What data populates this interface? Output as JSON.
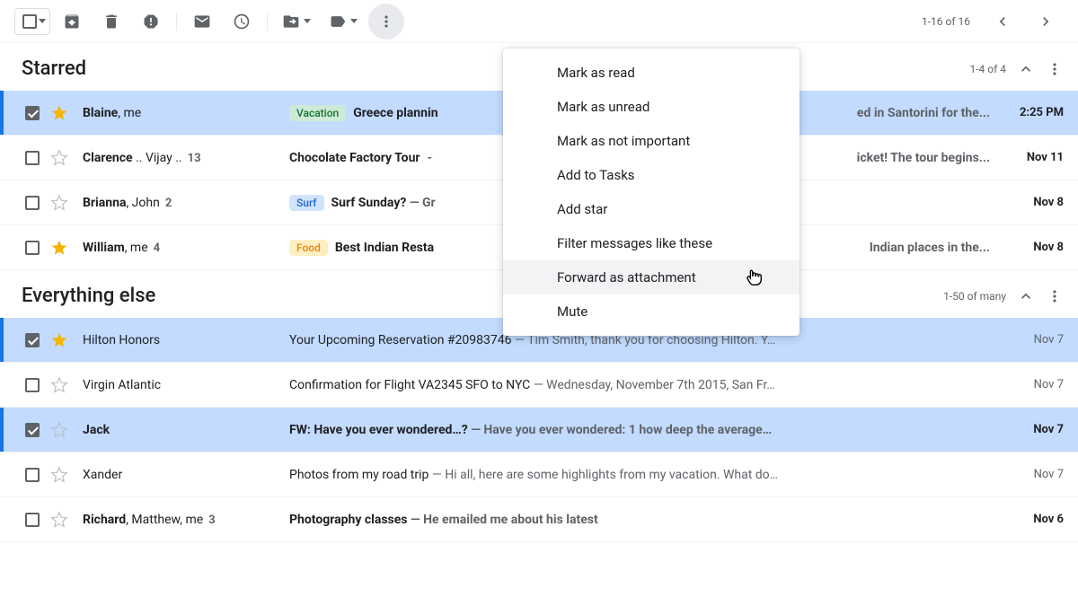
{
  "toolbar": {
    "pagination": "1-16 of 16"
  },
  "menu": {
    "items": [
      "Mark as read",
      "Mark as unread",
      "Mark as not important",
      "Add to Tasks",
      "Add star",
      "Filter messages like these",
      "Forward as attachment",
      "Mute"
    ],
    "hovered_index": 6
  },
  "sections": [
    {
      "title": "Starred",
      "count": "1-4 of 4",
      "rows": [
        {
          "selected": true,
          "starred": true,
          "unread": true,
          "sender": "Blaine",
          "sender_rest": ", me",
          "count": "",
          "label": {
            "text": "Vacation",
            "bg": "#ceead6",
            "fg": "#137333"
          },
          "subject": "Greece plannin",
          "snippet": "ed in Santorini for the...",
          "snippet_gap": true,
          "date": "2:25 PM"
        },
        {
          "selected": false,
          "starred": false,
          "unread": true,
          "sender": "Clarence",
          "sender_rest": " .. Vijay ..",
          "count": "13",
          "label": null,
          "subject": "Chocolate Factory Tour",
          "snippet": "icket! The tour begins...",
          "snippet_gap": true,
          "snippet_prefix": " - ",
          "date": "Nov 11"
        },
        {
          "selected": false,
          "starred": false,
          "unread": true,
          "sender": "Brianna",
          "sender_rest": ", John",
          "count": "2",
          "label": {
            "text": "Surf",
            "bg": "#d2e3fc",
            "fg": "#1967d2"
          },
          "subject": "Surf Sunday?",
          "snippet": " — Gr",
          "snippet_gap": false,
          "date": "Nov 8"
        },
        {
          "selected": false,
          "starred": true,
          "unread": true,
          "sender": "William",
          "sender_rest": ", me",
          "count": "4",
          "label": {
            "text": "Food",
            "bg": "#feefc3",
            "fg": "#ea8600"
          },
          "subject": "Best Indian Resta",
          "snippet": " Indian places in the...",
          "snippet_gap": true,
          "date": "Nov 8"
        }
      ]
    },
    {
      "title": "Everything else",
      "count": "1-50 of many",
      "rows": [
        {
          "selected": true,
          "starred": true,
          "unread": false,
          "sender": "Hilton Honors",
          "sender_rest": "",
          "count": "",
          "label": null,
          "subject": "Your Upcoming Reservation #20983746",
          "snippet": " — Tim Smith, thank you for choosing Hilton. Y…",
          "date": "Nov 7"
        },
        {
          "selected": false,
          "starred": false,
          "unread": false,
          "sender": "Virgin Atlantic",
          "sender_rest": "",
          "count": "",
          "label": null,
          "subject": "Confirmation for Flight VA2345 SFO to NYC",
          "snippet": " — Wednesday, November 7th 2015, San Fr…",
          "date": "Nov 7"
        },
        {
          "selected": true,
          "starred": false,
          "unread": true,
          "sender": "Jack",
          "sender_rest": "",
          "count": "",
          "label": null,
          "subject": "FW: Have you ever wondered…?",
          "snippet": " — Have you ever wondered: 1 how deep the average…",
          "date": "Nov 7"
        },
        {
          "selected": false,
          "starred": false,
          "unread": false,
          "sender": "Xander",
          "sender_rest": "",
          "count": "",
          "label": null,
          "subject": "Photos from my road trip",
          "snippet": " — Hi all, here are some highlights from my vacation. What do…",
          "date": "Nov 7"
        },
        {
          "selected": false,
          "starred": false,
          "unread": true,
          "sender": "Richard",
          "sender_rest": ", Matthew, me",
          "count": "3",
          "label": null,
          "subject": "Photography classes",
          "snippet": " — He emailed me about his latest",
          "date": "Nov 6"
        }
      ]
    }
  ]
}
